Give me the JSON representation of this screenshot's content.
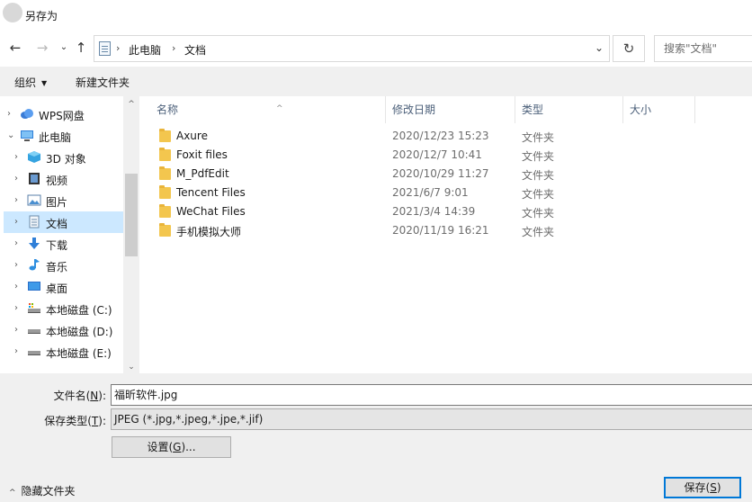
{
  "window": {
    "title": "另存为"
  },
  "address": {
    "crumbs": [
      "此电脑",
      "文档"
    ],
    "separator": "›"
  },
  "search": {
    "placeholder": "搜索\"文档\""
  },
  "toolbar": {
    "organize": "组织",
    "new_folder": "新建文件夹"
  },
  "nav_tree": [
    {
      "label": "WPS网盘",
      "icon": "cloud-icon",
      "level": 0,
      "expanded": false,
      "selected": false
    },
    {
      "label": "此电脑",
      "icon": "computer-icon",
      "level": 0,
      "expanded": true,
      "selected": false
    },
    {
      "label": "3D 对象",
      "icon": "3d-objects-icon",
      "level": 1,
      "expanded": false,
      "selected": false
    },
    {
      "label": "视频",
      "icon": "video-icon",
      "level": 1,
      "expanded": false,
      "selected": false
    },
    {
      "label": "图片",
      "icon": "pictures-icon",
      "level": 1,
      "expanded": false,
      "selected": false
    },
    {
      "label": "文档",
      "icon": "documents-icon",
      "level": 1,
      "expanded": false,
      "selected": true
    },
    {
      "label": "下载",
      "icon": "download-icon",
      "level": 1,
      "expanded": false,
      "selected": false
    },
    {
      "label": "音乐",
      "icon": "music-icon",
      "level": 1,
      "expanded": false,
      "selected": false
    },
    {
      "label": "桌面",
      "icon": "desktop-icon",
      "level": 1,
      "expanded": false,
      "selected": false
    },
    {
      "label": "本地磁盘 (C:)",
      "icon": "system-drive-icon",
      "level": 1,
      "expanded": false,
      "selected": false
    },
    {
      "label": "本地磁盘 (D:)",
      "icon": "drive-icon",
      "level": 1,
      "expanded": false,
      "selected": false
    },
    {
      "label": "本地磁盘 (E:)",
      "icon": "drive-icon",
      "level": 1,
      "expanded": false,
      "selected": false
    }
  ],
  "columns": {
    "name": "名称",
    "modified": "修改日期",
    "type": "类型",
    "size": "大小"
  },
  "files": [
    {
      "name": "Axure",
      "modified": "2020/12/23 15:23",
      "type": "文件夹"
    },
    {
      "name": "Foxit files",
      "modified": "2020/12/7 10:41",
      "type": "文件夹"
    },
    {
      "name": "M_PdfEdit",
      "modified": "2020/10/29 11:27",
      "type": "文件夹"
    },
    {
      "name": "Tencent Files",
      "modified": "2021/6/7 9:01",
      "type": "文件夹"
    },
    {
      "name": "WeChat Files",
      "modified": "2021/3/4 14:39",
      "type": "文件夹"
    },
    {
      "name": "手机模拟大师",
      "modified": "2020/11/19 16:21",
      "type": "文件夹"
    }
  ],
  "form": {
    "filename_label": "文件名(",
    "filename_key": "N",
    "filename_suffix": "):",
    "filename_value": "福昕软件.jpg",
    "filetype_label": "保存类型(",
    "filetype_key": "T",
    "filetype_suffix": "):",
    "filetype_value": "JPEG (*.jpg,*.jpeg,*.jpe,*.jif)",
    "settings_prefix": "设置(",
    "settings_key": "G",
    "settings_suffix": ")...",
    "hide_folders": "隐藏文件夹",
    "save_prefix": "保存(",
    "save_key": "S",
    "save_suffix": ")"
  },
  "colors": {
    "selection": "#cce8ff",
    "accent": "#0078d7",
    "folder": "#f3c64e",
    "panel": "#f0f0f0"
  }
}
